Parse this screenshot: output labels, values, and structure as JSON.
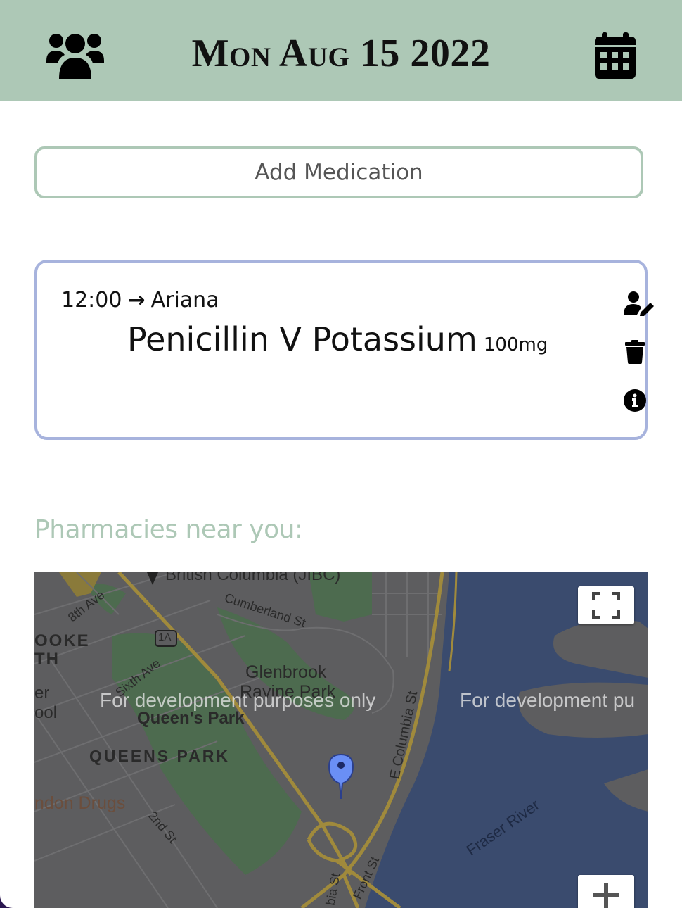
{
  "header": {
    "title": "Mon Aug 15 2022",
    "left_icon": "people-group-icon",
    "right_icon": "calendar-icon"
  },
  "actions": {
    "add_medication_label": "Add Medication"
  },
  "medication": {
    "time": "12:00",
    "arrow": "→",
    "patient": "Ariana",
    "name": "Penicillin V Potassium",
    "dose": "100mg",
    "icons": [
      "user-edit-icon",
      "trash-icon",
      "info-circle-icon"
    ]
  },
  "pharmacies": {
    "heading": "Pharmacies near you:"
  },
  "map": {
    "watermark_left": "For development purposes only",
    "watermark_right": "For development pu",
    "labels": {
      "jibc": "British Columbia (JIBC)",
      "eighth_ave": "8th Ave",
      "cumberland": "Cumberland St",
      "brooke": "OOKE",
      "th": "TH",
      "route": "1A",
      "sixth_ave": "Sixth Ave",
      "glenbrook": "Glenbrook",
      "ravine": "Ravine Park",
      "queens_park_place": "Queen's Park",
      "queens_park_area": "QUEENS PARK",
      "er": "er",
      "ool": "ool",
      "london_drugs": "ndon Drugs",
      "second_st": "2nd St",
      "e_columbia": "E Columbia St",
      "fraser_river": "Fraser River",
      "front_st": "Front St",
      "bia_st": "bia St"
    },
    "colors": {
      "land": "#5d5d5f",
      "water": "#3a4b6e",
      "park": "#4d6b4f",
      "road": "#a08a3c",
      "marker": "#6a8ff5"
    }
  }
}
